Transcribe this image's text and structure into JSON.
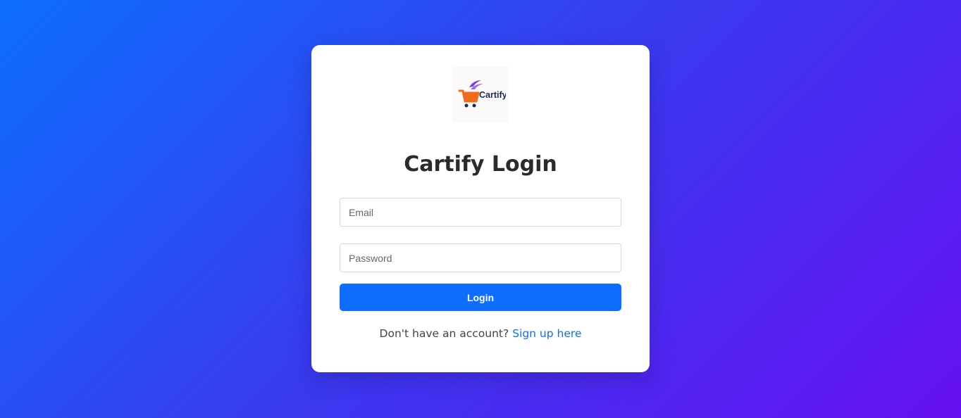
{
  "brand": {
    "logo_text": "Cartify",
    "logo_icon": "shopping-cart-icon",
    "colors": {
      "cart_orange": "#f26a1b",
      "wing_purple": "#7b3fe4",
      "text_navy": "#1d2a57"
    }
  },
  "login": {
    "title": "Cartify Login",
    "email_placeholder": "Email",
    "password_placeholder": "Password",
    "submit_label": "Login",
    "signup_prompt": "Don't have an account?",
    "signup_link": "Sign up here"
  },
  "theme": {
    "gradient_start": "#0d6efd",
    "gradient_end": "#6610f2",
    "primary": "#0d6efd"
  }
}
